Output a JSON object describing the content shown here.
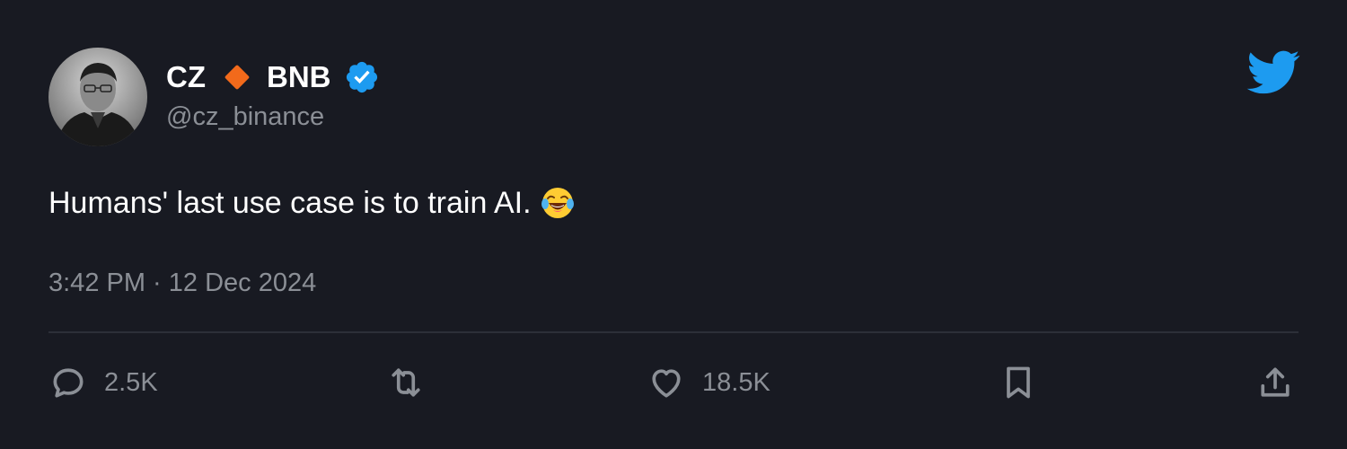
{
  "author": {
    "name_first": "CZ",
    "name_second": "BNB",
    "handle": "@cz_binance",
    "verified": true,
    "diamond_color": "#f26a1b",
    "verified_color": "#1d9bf0"
  },
  "tweet": {
    "text": "Humans' last use case is to train AI.",
    "emoji": "face-with-tears-of-joy"
  },
  "meta": {
    "timestamp": "3:42 PM · 12 Dec 2024"
  },
  "actions": {
    "reply_count": "2.5K",
    "like_count": "18.5K"
  },
  "brand": {
    "logo": "twitter-bird-icon",
    "color": "#1d9bf0"
  }
}
